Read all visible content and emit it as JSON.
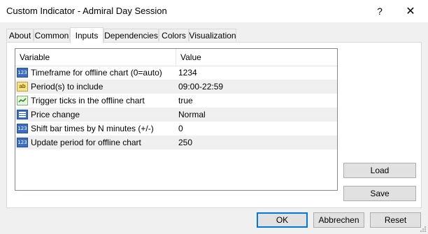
{
  "window": {
    "title": "Custom Indicator - Admiral Day Session",
    "help_glyph": "?",
    "close_glyph": "✕"
  },
  "tabs": [
    {
      "label": "About"
    },
    {
      "label": "Common"
    },
    {
      "label": "Inputs"
    },
    {
      "label": "Dependencies"
    },
    {
      "label": "Colors"
    },
    {
      "label": "Visualization"
    }
  ],
  "active_tab": "Inputs",
  "inputs_table": {
    "headers": {
      "variable": "Variable",
      "value": "Value"
    },
    "rows": [
      {
        "icon": "integer-icon",
        "icon_text": "123",
        "name": "Timeframe for offline chart (0=auto)",
        "value": "1234"
      },
      {
        "icon": "string-icon",
        "icon_text": "ab",
        "name": "Period(s) to include",
        "value": "09:00-22:59"
      },
      {
        "icon": "boolean-icon",
        "icon_text": "",
        "name": "Trigger ticks in the offline chart",
        "value": "true"
      },
      {
        "icon": "enum-icon",
        "icon_text": "",
        "name": "Price change",
        "value": "Normal"
      },
      {
        "icon": "integer-icon",
        "icon_text": "123",
        "name": "Shift bar times by N minutes (+/-)",
        "value": "0"
      },
      {
        "icon": "integer-icon",
        "icon_text": "123",
        "name": "Update period for offline chart",
        "value": "250"
      }
    ]
  },
  "buttons": {
    "load": "Load",
    "save": "Save",
    "ok": "OK",
    "cancel": "Abbrechen",
    "reset": "Reset"
  },
  "colors": {
    "accent": "#0078d7",
    "row_alt": "#f0f0f0",
    "window_bg": "#f0f0f0"
  }
}
